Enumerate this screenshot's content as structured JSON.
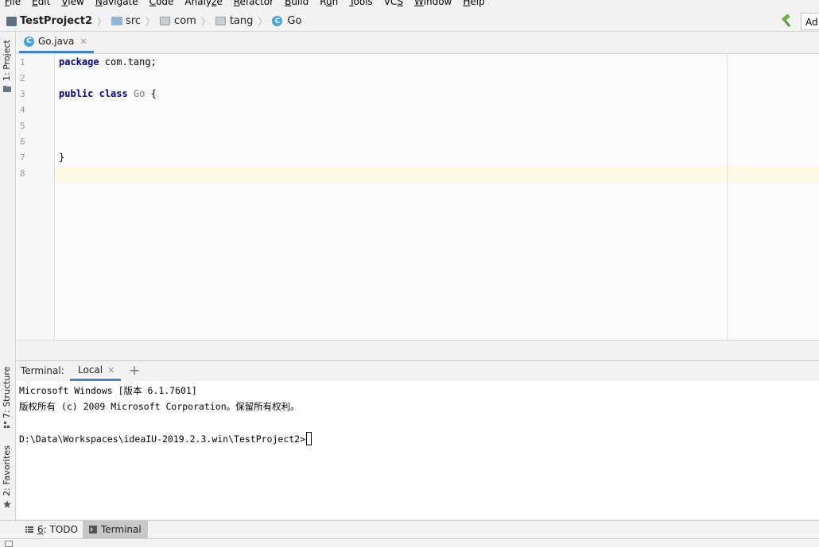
{
  "menu": [
    {
      "pre": "",
      "u": "F",
      "post": "ile"
    },
    {
      "pre": "",
      "u": "E",
      "post": "dit"
    },
    {
      "pre": "",
      "u": "V",
      "post": "iew"
    },
    {
      "pre": "",
      "u": "N",
      "post": "avigate"
    },
    {
      "pre": "",
      "u": "C",
      "post": "ode"
    },
    {
      "pre": "Analy",
      "u": "z",
      "post": "e"
    },
    {
      "pre": "",
      "u": "R",
      "post": "efactor"
    },
    {
      "pre": "",
      "u": "B",
      "post": "uild"
    },
    {
      "pre": "R",
      "u": "u",
      "post": "n"
    },
    {
      "pre": "",
      "u": "T",
      "post": "ools"
    },
    {
      "pre": "VC",
      "u": "S",
      "post": ""
    },
    {
      "pre": "",
      "u": "W",
      "post": "indow"
    },
    {
      "pre": "",
      "u": "H",
      "post": "elp"
    }
  ],
  "breadcrumbs": {
    "project": "TestProject2",
    "src": "src",
    "com": "com",
    "tang": "tang",
    "class_letter": "C",
    "class_name": "Go"
  },
  "toolbar": {
    "add_config": "Ad"
  },
  "left_strip": {
    "project": "1: Project",
    "structure": "7: Structure",
    "favorites": "2: Favorites"
  },
  "editor": {
    "tab_label": "Go.java",
    "tab_icon_letter": "C",
    "line_numbers": [
      "1",
      "2",
      "3",
      "4",
      "5",
      "6",
      "7",
      "8"
    ],
    "code": {
      "l1_kw": "package",
      "l1_rest": " com.tang;",
      "l3_kw1": "public",
      "l3_kw2": "class",
      "l3_name": "Go",
      "l3_brace": " {",
      "l7": "}"
    }
  },
  "terminal": {
    "title": "Terminal:",
    "tab": "Local",
    "add": "+",
    "lines": [
      "Microsoft Windows [版本 6.1.7601]",
      "版权所有 (c) 2009 Microsoft Corporation。保留所有权利。",
      "",
      "D:\\Data\\Workspaces\\ideaIU-2019.2.3.win\\TestProject2>"
    ]
  },
  "bottom_tabs": {
    "todo_prefix": "",
    "todo_u": "6",
    "todo_rest": ": TODO",
    "terminal": "Terminal"
  }
}
